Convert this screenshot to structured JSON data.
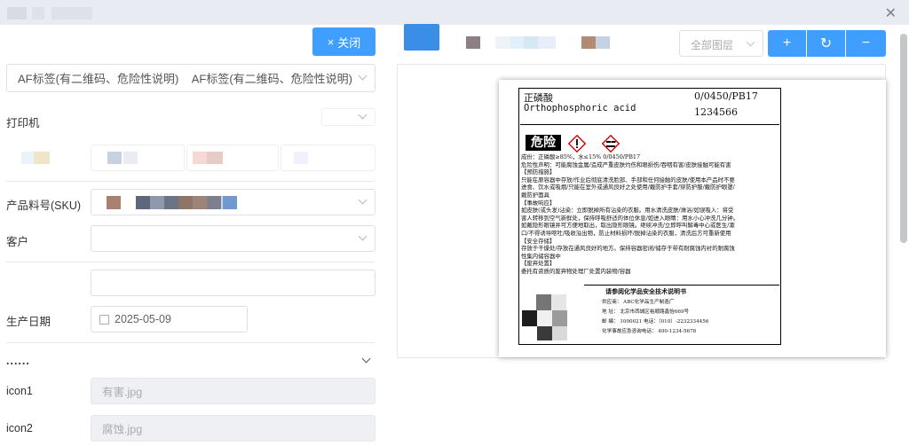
{
  "window": {
    "close_icon": "close-icon"
  },
  "left": {
    "close_button": "关闭",
    "close_button_icon": "×",
    "label_template": {
      "value": "AF标签(有二维码、危险性说明)    AF标签(有二维码、危险性说明)"
    },
    "printer_label": "打印机",
    "sku_label": "产品料号(SKU)",
    "customer_label": "客户",
    "production_date_label": "生产日期",
    "production_date_value": "2025-05-09",
    "collapse_label": "......",
    "icon1_label": "icon1",
    "icon1_value": "有害.jpg",
    "icon2_label": "icon2",
    "icon2_value": "腐蚀.jpg"
  },
  "toolbar": {
    "layer_select": "全部图层",
    "zoom_in": "+",
    "refresh": "↻",
    "zoom_out": "−"
  },
  "label_doc": {
    "name_cn": "正磷酸",
    "code": "0/0450/PB17",
    "name_en": "Orthophosphoric acid",
    "batch": "1234566",
    "danger_word": "危险",
    "lines": [
      "成份：正磷酸≥85%，水≤15% 0/0450/PB17",
      "危险性声明：可能腐蚀金属/造成严重皮肤灼伤和眼损伤/吞咽有害/皮肤接触可能有害",
      "【预防措施】",
      "只能在原容器中存放/作业后彻底清洗脸部、手部和任何接触的皮肤/使用本产品时不要",
      "进食、饮水或吸烟/只能在室外或通风良好之处使用/戴防护手套/穿防护服/戴防护眼罩/",
      "戴防护面具",
      "【事故响应】",
      "如皮肤(或头发)沾染：立即脱掉所有沾染的衣服。用水清洗皮肤/淋浴/如误吸入：将受",
      "害人转移到空气新鲜处，保持呼吸舒适的体位休息/如进入眼睛：用水小心冲洗几分钟。",
      "如戴隐形眼镜并可方便地取出，取出隐形眼镜。继续冲洗/立即呼叫解毒中心或医生/漱",
      "口/不得诱导呕吐/吸收溢出物，防止材料损坏/脱掉沾染的衣服，清洗后方可重新使用",
      "【安全存储】",
      "存放于干燥处/存放在通风良好的地方。保持容器密闭/储存于带有耐腐蚀内衬的耐腐蚀",
      "性集内储容器中",
      "【废弃处置】",
      "委托有资质的废弃物处理厂处置内装物/容器"
    ],
    "sheet_title": "请参阅化学品安全技术说明书",
    "sheet_lines": [
      "供应商：  ABC化学品生产制造厂",
      "地  址：  北京市西城区裕顺路鑫怡669号",
      "邮  编：  1000021              电话：（010）-2232334456",
      "化学事故应急咨询电话：  400-1234-5678"
    ]
  }
}
